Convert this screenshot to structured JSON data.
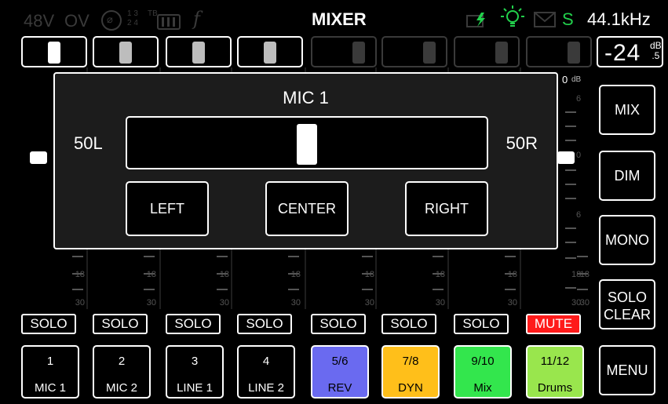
{
  "status": {
    "phantom": "48V",
    "overload": "OV",
    "phase_icon": "phase-icon",
    "routing_top": "1 3",
    "routing_bottom": "2 4",
    "tb_label": "TB",
    "mix_icon": "mixer-icon",
    "fx_icon": "f",
    "title": "MIXER",
    "battery_icon": "battery-charging-icon",
    "bulb_icon": "lightbulb-icon",
    "mail_icon": "mail-icon",
    "sync": "S",
    "sample_rate": "44.1kHz"
  },
  "pan_overview": [
    {
      "channel": "1",
      "pan": 0.5,
      "active": true,
      "shade": "white"
    },
    {
      "channel": "2",
      "pan": 0.5,
      "active": true,
      "shade": "grey"
    },
    {
      "channel": "3",
      "pan": 0.5,
      "active": true,
      "shade": "grey"
    },
    {
      "channel": "4",
      "pan": 0.5,
      "active": true,
      "shade": "grey"
    },
    {
      "channel": "5/6",
      "pan": 0.8,
      "active": false,
      "shade": "dark"
    },
    {
      "channel": "7/8",
      "pan": 0.8,
      "active": false,
      "shade": "dark"
    },
    {
      "channel": "9/10",
      "pan": 0.8,
      "active": false,
      "shade": "dark"
    },
    {
      "channel": "11/12",
      "pan": 0.8,
      "active": false,
      "shade": "dark"
    }
  ],
  "meter": {
    "value": "-24",
    "unit_top": "dB",
    "unit_bottom": ".5"
  },
  "scale": {
    "zero": "0",
    "db": "dB",
    "six": "6",
    "eighteen": "18",
    "thirty": "30",
    "zero_dim": "0"
  },
  "solo_labels": [
    "SOLO",
    "SOLO",
    "SOLO",
    "SOLO",
    "SOLO",
    "SOLO",
    "SOLO"
  ],
  "mute_label": "MUTE",
  "channels": [
    {
      "num": "1",
      "name": "MIC 1",
      "style": "plain"
    },
    {
      "num": "2",
      "name": "MIC 2",
      "style": "plain"
    },
    {
      "num": "3",
      "name": "LINE 1",
      "style": "plain"
    },
    {
      "num": "4",
      "name": "LINE 2",
      "style": "plain"
    },
    {
      "num": "5/6",
      "name": "REV",
      "style": "rev",
      "color": "#6a6af0"
    },
    {
      "num": "7/8",
      "name": "DYN",
      "style": "dyn",
      "color": "#ffbf1a"
    },
    {
      "num": "9/10",
      "name": "Mix",
      "style": "mix",
      "color": "#33e64d"
    },
    {
      "num": "11/12",
      "name": "Drums",
      "style": "drums",
      "color": "#99e64d"
    }
  ],
  "side_buttons": {
    "mix": "MIX",
    "dim": "DIM",
    "mono": "MONO",
    "solo_clear_1": "SOLO",
    "solo_clear_2": "CLEAR",
    "menu": "MENU"
  },
  "popup": {
    "title": "MIC 1",
    "left_label": "50L",
    "right_label": "50R",
    "pan": 0.5,
    "btn_left": "LEFT",
    "btn_center": "CENTER",
    "btn_right": "RIGHT"
  },
  "colors": {
    "mute": "#ff1a1a",
    "sync": "#22d14c",
    "accent": "#ffffff"
  }
}
